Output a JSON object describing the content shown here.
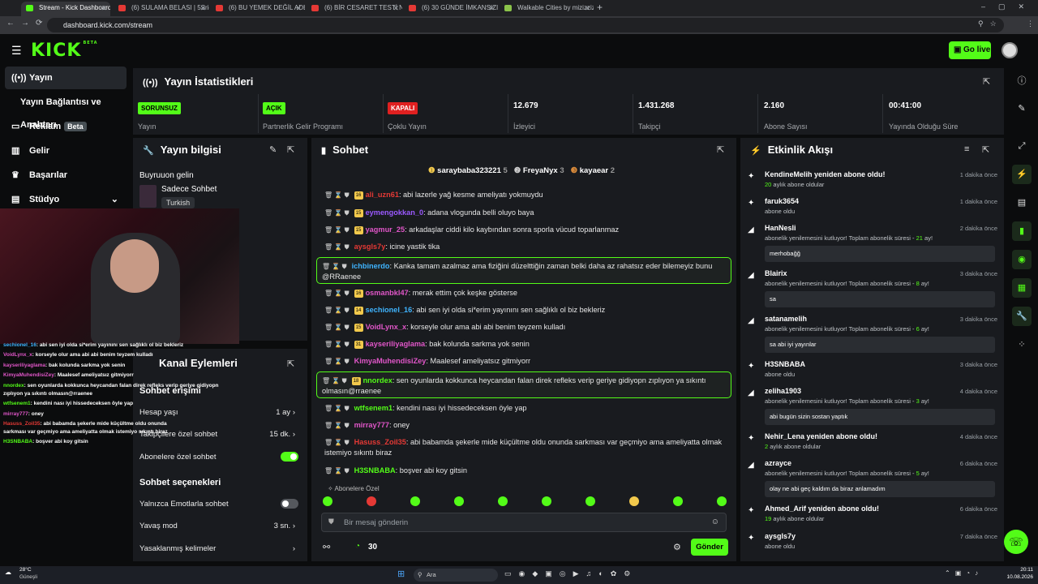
{
  "browser": {
    "tabs": [
      {
        "label": "Stream - Kick Dashboard",
        "active": true
      },
      {
        "label": "(6) SULAMA BELASI | 5Sriders |"
      },
      {
        "label": "(6) BU YEMEK DEĞİL ADETA ŞÖ"
      },
      {
        "label": "(6) BİR CESARET TESTİ NASIL F"
      },
      {
        "label": "(6) 30 GÜNDE İMKANSIZI BAŞA"
      },
      {
        "label": "Walkable Cities by mizizziz"
      }
    ],
    "url": "dashboard.kick.com/stream",
    "new_tab": "+"
  },
  "header": {
    "logo": "KICK",
    "logo_tag": "BETA",
    "go_live": "Go live"
  },
  "sidebar": {
    "items": [
      {
        "label": "Yayın",
        "icon": "broadcast-icon"
      },
      {
        "label": "Yayın Bağlantısı ve Anahtarı"
      },
      {
        "label": "Reklam",
        "badge": "Beta",
        "icon": "ad-icon"
      },
      {
        "label": "Gelir",
        "icon": "chart-icon"
      },
      {
        "label": "Başarılar",
        "icon": "trophy-icon"
      },
      {
        "label": "Stüdyo",
        "icon": "studio-icon"
      }
    ]
  },
  "stats": {
    "title": "Yayın İstatistikleri",
    "items": [
      {
        "badge": "SORUNSUZ",
        "label": "Yayın",
        "badge_color": "#53fc18"
      },
      {
        "badge": "AÇIK",
        "label": "Partnerlik Gelir Programı",
        "badge_color": "#53fc18"
      },
      {
        "badge": "KAPALI",
        "label": "Çoklu Yayın",
        "badge_color": "#e02020"
      },
      {
        "value": "12.679",
        "label": "İzleyici"
      },
      {
        "value": "1.431.268",
        "label": "Takipçi"
      },
      {
        "value": "2.160",
        "label": "Abone Sayısı"
      },
      {
        "value": "00:41:00",
        "label": "Yayında Olduğu Süre"
      }
    ]
  },
  "info": {
    "title": "Yayın bilgisi",
    "subtitle": "Buyruuon gelin",
    "category": "Sadece Sohbet",
    "tag": "Turkish"
  },
  "channel": {
    "title": "Kanal Eylemleri",
    "section1": "Sohbet erişimi",
    "rows": [
      {
        "label": "Hesap yaşı",
        "value": "1 ay"
      },
      {
        "label": "Takipçilere özel sohbet",
        "value": "15 dk."
      },
      {
        "label": "Abonelere özel sohbet"
      }
    ],
    "section2": "Sohbet seçenekleri",
    "rows2": [
      {
        "label": "Yalnızca Emotlarla sohbet"
      },
      {
        "label": "Yavaş mod",
        "value": "3 sn."
      },
      {
        "label": "Yasaklanmış kelimeler"
      }
    ]
  },
  "chat": {
    "title": "Sohbet",
    "top": [
      {
        "name": "saraybaba323221",
        "n": "5"
      },
      {
        "name": "FreyaNyx",
        "n": "3"
      },
      {
        "name": "kayaear",
        "n": "2"
      }
    ],
    "messages": [
      {
        "sub": "16",
        "user": "ali_uzn61",
        "color": "#e53935",
        "text": "abi lazerle yağ kesme ameliyatı yokmuydu"
      },
      {
        "sub": "15",
        "user": "eymengokkan_0",
        "color": "#9b59ff",
        "text": "adana vlogunda belli oluyo baya"
      },
      {
        "sub": "15",
        "user": "yagmur_25",
        "color": "#e056c8",
        "text": "arkadaşlar ciddi kilo kaybından sonra sporla vücud toparlanmaz"
      },
      {
        "user": "aysgls7y",
        "color": "#e53935",
        "text": "icine yastik tika"
      },
      {
        "user": "ichbinerdo",
        "color": "#3fb4ff",
        "text": "Kanka tamam azalmaz ama fiziğini düzelttiğin zaman belki daha az rahatsız eder bilemeyiz bunu @RRaenee",
        "hl": true
      },
      {
        "sub": "16",
        "user": "osmanbkl47",
        "color": "#e056c8",
        "text": "merak ettim çok keşke gösterse"
      },
      {
        "sub": "14",
        "user": "sechionel_16",
        "color": "#3fb4ff",
        "text": "abi sen iyi olda si*erim yayınını sen sağlıklı ol biz bekleriz"
      },
      {
        "sub": "15",
        "user": "VoidLynx_x",
        "color": "#e056c8",
        "text": "korseyle olur ama abi abi benim teyzem kulladı"
      },
      {
        "sub": "31",
        "user": "kayseriliyaglama",
        "color": "#e056c8",
        "text": "bak kolunda sarkma yok senin"
      },
      {
        "user": "KimyaMuhendisiZey",
        "color": "#e056c8",
        "text": "Maalesef ameliyatsız gitmiyorr"
      },
      {
        "sub": "18",
        "user": "nnordex",
        "color": "#53fc18",
        "text": "sen oyunlarda kokkunca heycandan falan direk refleks verip geriye gidiyopn zıplıyon ya sıkıntı olmasın@rraenee",
        "hl": true
      },
      {
        "user": "wtfsenem1",
        "color": "#53fc18",
        "text": "kendini nası iyi hissedeceksen öyle yap"
      },
      {
        "user": "mirray777",
        "color": "#e056c8",
        "text": "oney"
      },
      {
        "user": "Hasuss_Zoil35",
        "color": "#e53935",
        "text": "abi babamda şekerle mide küçültme oldu onunda sarkması var geçmiyo ama ameliyatta olmak istemiyo sıkıntı biraz"
      },
      {
        "user": "H3SNBABA",
        "color": "#53fc18",
        "text": "boşver abi koy gitsin"
      }
    ],
    "emote_label": "Abonelere Özel",
    "input_placeholder": "Bir mesaj gönderin",
    "points": "30",
    "send": "Gönder"
  },
  "activity": {
    "title": "Etkinlik Akışı",
    "items": [
      {
        "name": "KendineMelih yeniden abone oldu!",
        "sub_n": "20",
        "sub": " aylık abone oldular",
        "time": "1 dakika önce"
      },
      {
        "name": "faruk3654",
        "sub": "abone oldu",
        "time": "1 dakika önce"
      },
      {
        "name": "HanNesli",
        "sub": "abonelik yenilemesini kutluyor! Toplam abonelik süresi - ",
        "sub_n2": "21",
        "sub2": " ay!",
        "time": "2 dakika önce",
        "box": "merhobağğ"
      },
      {
        "name": "Blairix",
        "sub": "abonelik yenilemesini kutluyor! Toplam abonelik süresi - ",
        "sub_n2": "8",
        "sub2": " ay!",
        "time": "3 dakika önce",
        "box": "sa"
      },
      {
        "name": "satanamelih",
        "sub": "abonelik yenilemesini kutluyor! Toplam abonelik süresi - ",
        "sub_n2": "6",
        "sub2": " ay!",
        "time": "3 dakika önce",
        "box": "sa abi iyi yayınlar"
      },
      {
        "name": "H3SNBABA",
        "sub": "abone oldu",
        "time": "3 dakika önce"
      },
      {
        "name": "zeliha1903",
        "sub": "abonelik yenilemesini kutluyor! Toplam abonelik süresi - ",
        "sub_n2": "3",
        "sub2": " ay!",
        "time": "4 dakika önce",
        "box": "abi bugün sizin sostan yaptık"
      },
      {
        "name": "Nehir_Lena yeniden abone oldu!",
        "sub_n": "2",
        "sub": " aylık abone oldular",
        "time": "4 dakika önce"
      },
      {
        "name": "azrayce",
        "sub": "abonelik yenilemesini kutluyor! Toplam abonelik süresi - ",
        "sub_n2": "5",
        "sub2": " ay!",
        "time": "6 dakika önce",
        "box": "olay ne abi geç kaldım da biraz anlamadım"
      },
      {
        "name": "Ahmed_Arif yeniden abone oldu!",
        "sub_n": "19",
        "sub": " aylık abone oldular",
        "time": "6 dakika önce"
      },
      {
        "name": "aysgls7y",
        "sub": "abone oldu",
        "time": "7 dakika önce"
      }
    ]
  },
  "overlay": {
    "lines": [
      {
        "user": "sechionel_16",
        "text": "abi sen iyi olda si*erim yayınını sen sağlıklı ol biz bekleriz"
      },
      {
        "user": "VoidLynx_x",
        "text": "korseyle olur ama abi abi benim teyzem kulladı"
      },
      {
        "user": "kayseriliyaglama",
        "text": "bak kolunda sarkma yok senin"
      },
      {
        "user": "KimyaMuhendisiZey",
        "text": "Maalesef ameliyatsız gitmiyorr"
      },
      {
        "user": "nnordex",
        "text": "sen oyunlarda kokkunca heycandan falan direk refleks verip geriye gidiyopn"
      },
      {
        "user": "",
        "text": "zıplıyon ya sıkıntı olmasın@rraenee"
      },
      {
        "user": "wtfsenem1",
        "text": "kendini nası iyi hissedeceksen öyle yap"
      },
      {
        "user": "mirray777",
        "text": "oney"
      },
      {
        "user": "Hasuss_Zoil35",
        "text": "abi babamda şekerle mide küçültme oldu onunda"
      },
      {
        "user": "",
        "text": "sarkması var geçmiyo ama ameliyatta olmak istemiyo sıkıntı biraz"
      },
      {
        "user": "H3SNBABA",
        "text": "boşver abi koy gitsin"
      }
    ]
  },
  "taskbar": {
    "weather_temp": "28°C",
    "weather_desc": "Güneşli",
    "search": "Ara",
    "time": "20:11",
    "date": "10.08.2026"
  }
}
